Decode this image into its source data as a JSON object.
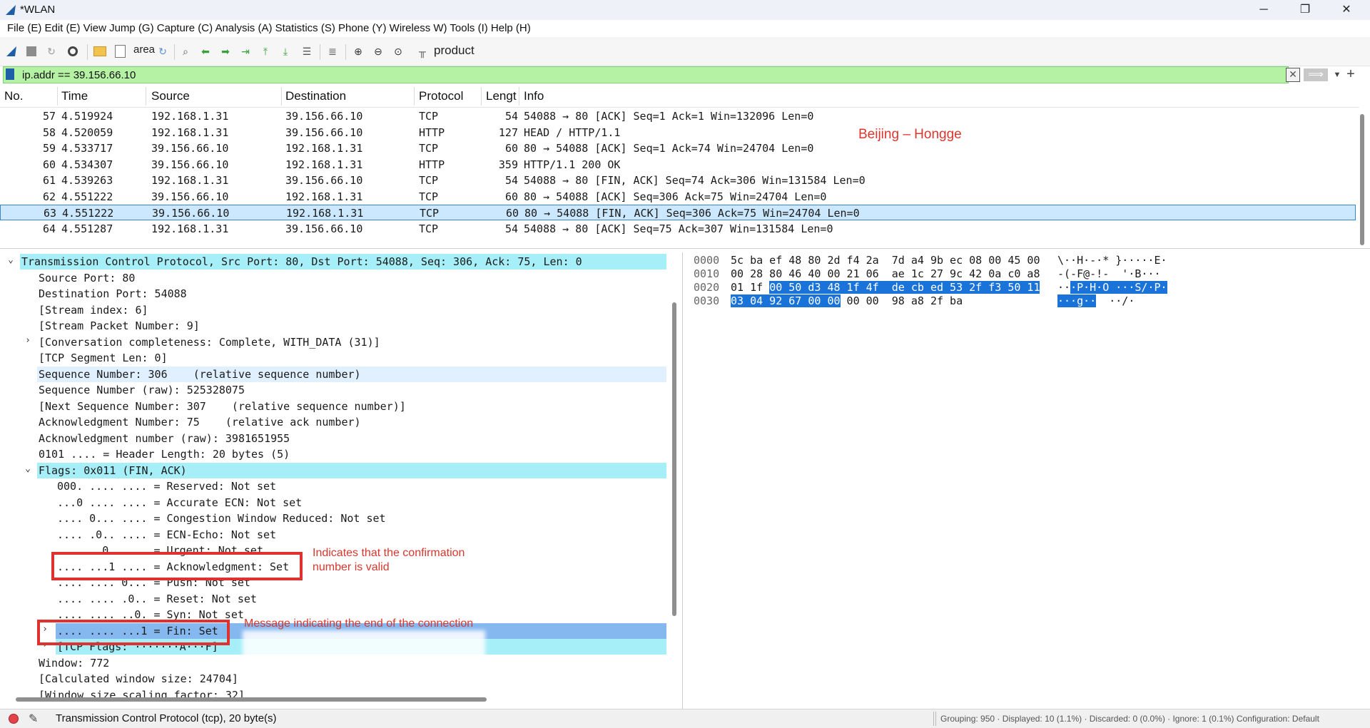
{
  "window": {
    "title": "*WLAN",
    "minimize": "─",
    "maximize": "❐",
    "close": "✕"
  },
  "menu": {
    "text": "File (E) Edit (E) View Jump (G) Capture (C) Analysis (A) Statistics (S) Phone (Y) Wireless W) Tools (I) Help (H)"
  },
  "toolbar": {
    "area_label": "area",
    "product_label": "product",
    "icons": [
      "shark-fin-icon",
      "stop-icon",
      "restart-icon",
      "options-gear-icon",
      "open-folder-icon",
      "save-file-icon",
      "reload-icon",
      "find-icon",
      "back-arrow-icon",
      "forward-arrow-icon",
      "go-to-packet-icon",
      "first-packet-icon",
      "last-packet-icon",
      "autoscroll-icon",
      "colorize-icon",
      "zoom-in-icon",
      "zoom-out-icon",
      "zoom-reset-icon",
      "resize-columns-icon"
    ]
  },
  "filter": {
    "value": "ip.addr == 39.156.66.10"
  },
  "packet_list": {
    "columns": [
      "No.",
      "Time",
      "Source",
      "Destination",
      "Protocol",
      "Lengt",
      "Info"
    ],
    "rows": [
      {
        "no": "57",
        "time": "4.519924",
        "src": "192.168.1.31",
        "dst": "39.156.66.10",
        "proto": "TCP",
        "len": "54",
        "info": "54088 → 80 [ACK] Seq=1 Ack=1 Win=132096 Len=0"
      },
      {
        "no": "58",
        "time": "4.520059",
        "src": "192.168.1.31",
        "dst": "39.156.66.10",
        "proto": "HTTP",
        "len": "127",
        "info": "HEAD / HTTP/1.1"
      },
      {
        "no": "59",
        "time": "4.533717",
        "src": "39.156.66.10",
        "dst": "192.168.1.31",
        "proto": "TCP",
        "len": "60",
        "info": "80 → 54088 [ACK] Seq=1 Ack=74 Win=24704 Len=0"
      },
      {
        "no": "60",
        "time": "4.534307",
        "src": "39.156.66.10",
        "dst": "192.168.1.31",
        "proto": "HTTP",
        "len": "359",
        "info": "HTTP/1.1 200 OK"
      },
      {
        "no": "61",
        "time": "4.539263",
        "src": "192.168.1.31",
        "dst": "39.156.66.10",
        "proto": "TCP",
        "len": "54",
        "info": "54088 → 80 [FIN, ACK] Seq=74 Ack=306 Win=131584 Len=0"
      },
      {
        "no": "62",
        "time": "4.551222",
        "src": "39.156.66.10",
        "dst": "192.168.1.31",
        "proto": "TCP",
        "len": "60",
        "info": "80 → 54088 [ACK] Seq=306 Ack=75 Win=24704 Len=0"
      },
      {
        "no": "63",
        "time": "4.551222",
        "src": "39.156.66.10",
        "dst": "192.168.1.31",
        "proto": "TCP",
        "len": "60",
        "info": "80 → 54088 [FIN, ACK] Seq=306 Ack=75 Win=24704 Len=0"
      },
      {
        "no": "64",
        "time": "4.551287",
        "src": "192.168.1.31",
        "dst": "39.156.66.10",
        "proto": "TCP",
        "len": "54",
        "info": "54088 → 80 [ACK] Seq=75 Ack=307 Win=131584 Len=0"
      }
    ],
    "annotation": "Beijing – Hongge"
  },
  "details": {
    "rows": [
      {
        "text": "Transmission Control Protocol, Src Port: 80, Dst Port: 54088, Seq: 306, Ack: 75, Len: 0",
        "exp": "⌄"
      },
      {
        "text": "Source Port: 80",
        "exp": ""
      },
      {
        "text": "Destination Port: 54088",
        "exp": ""
      },
      {
        "text": "[Stream index: 6]",
        "exp": ""
      },
      {
        "text": "[Stream Packet Number: 9]",
        "exp": ""
      },
      {
        "text": "[Conversation completeness: Complete, WITH_DATA (31)]",
        "exp": "›"
      },
      {
        "text": "[TCP Segment Len: 0]",
        "exp": ""
      },
      {
        "text": "Sequence Number: 306    (relative sequence number)",
        "exp": ""
      },
      {
        "text": "Sequence Number (raw): 525328075",
        "exp": ""
      },
      {
        "text": "[Next Sequence Number: 307    (relative sequence number)]",
        "exp": ""
      },
      {
        "text": "Acknowledgment Number: 75    (relative ack number)",
        "exp": ""
      },
      {
        "text": "Acknowledgment number (raw): 3981651955",
        "exp": ""
      },
      {
        "text": "0101 .... = Header Length: 20 bytes (5)",
        "exp": ""
      },
      {
        "text": "Flags: 0x011 (FIN, ACK)",
        "exp": "⌄"
      },
      {
        "text": "000. .... .... = Reserved: Not set",
        "exp": ""
      },
      {
        "text": "...0 .... .... = Accurate ECN: Not set",
        "exp": ""
      },
      {
        "text": ".... 0... .... = Congestion Window Reduced: Not set",
        "exp": ""
      },
      {
        "text": ".... .0.. .... = ECN-Echo: Not set",
        "exp": ""
      },
      {
        "text": ".... ..0. .... = Urgent: Not set",
        "exp": ""
      },
      {
        "text": ".... ...1 .... = Acknowledgment: Set",
        "exp": ""
      },
      {
        "text": ".... .... 0... = Push: Not set",
        "exp": ""
      },
      {
        "text": ".... .... .0.. = Reset: Not set",
        "exp": ""
      },
      {
        "text": ".... .... ..0. = Syn: Not set",
        "exp": ""
      },
      {
        "text": ".... .... ...1 = Fin: Set",
        "exp": "›"
      },
      {
        "text": "[TCP Flags: ·······A···F]",
        "exp": "›"
      },
      {
        "text": "Window: 772",
        "exp": ""
      },
      {
        "text": "[Calculated window size: 24704]",
        "exp": ""
      },
      {
        "text": "[Window size scaling factor: 32]",
        "exp": ""
      }
    ],
    "annot_ack": "Indicates that the confirmation\nnumber is valid",
    "annot_fin": "Message indicating the end of the connection"
  },
  "bytes": {
    "rows": [
      {
        "off": "0000",
        "hex_pre": "5c ba ef 48 80 2d f4 2a  7d a4 9b ec 08 00 45 00",
        "hex_sel": "",
        "hex_post": "",
        "asc_pre": "\\··H·-·* }·····E·",
        "asc_sel": "",
        "asc_post": ""
      },
      {
        "off": "0010",
        "hex_pre": "00 28 80 46 40 00 21 06  ae 1c 27 9c 42 0a c0 a8",
        "hex_sel": "",
        "hex_post": "",
        "asc_pre": "-(-F@-!-  '·B···",
        "asc_sel": "",
        "asc_post": ""
      },
      {
        "off": "0020",
        "hex_pre": "01 1f ",
        "hex_sel": "00 50 d3 48 1f 4f  de cb ed 53 2f f3 50 11",
        "hex_post": "",
        "asc_pre": "··",
        "asc_sel": "·P·H·O ···S/·P·",
        "asc_post": ""
      },
      {
        "off": "0030",
        "hex_pre": "",
        "hex_sel": "03 04 92 67 00 00",
        "hex_post": " 00 00  98 a8 2f ba",
        "asc_pre": "",
        "asc_sel": "···g··",
        "asc_post": "  ··/·"
      }
    ]
  },
  "status": {
    "text": "Transmission Control Protocol (tcp), 20 byte(s)",
    "stats": "Grouping: 950 · Displayed: 10 (1.1%) · Discarded: 0 (0.0%) · Ignore: 1 (0.1%) Configuration: Default"
  },
  "colors": {
    "selected_row": "#cbe8ff",
    "filter_ok": "#b5f2a4",
    "header_highlight": "#a6eff8",
    "annotation": "#d9372e"
  }
}
